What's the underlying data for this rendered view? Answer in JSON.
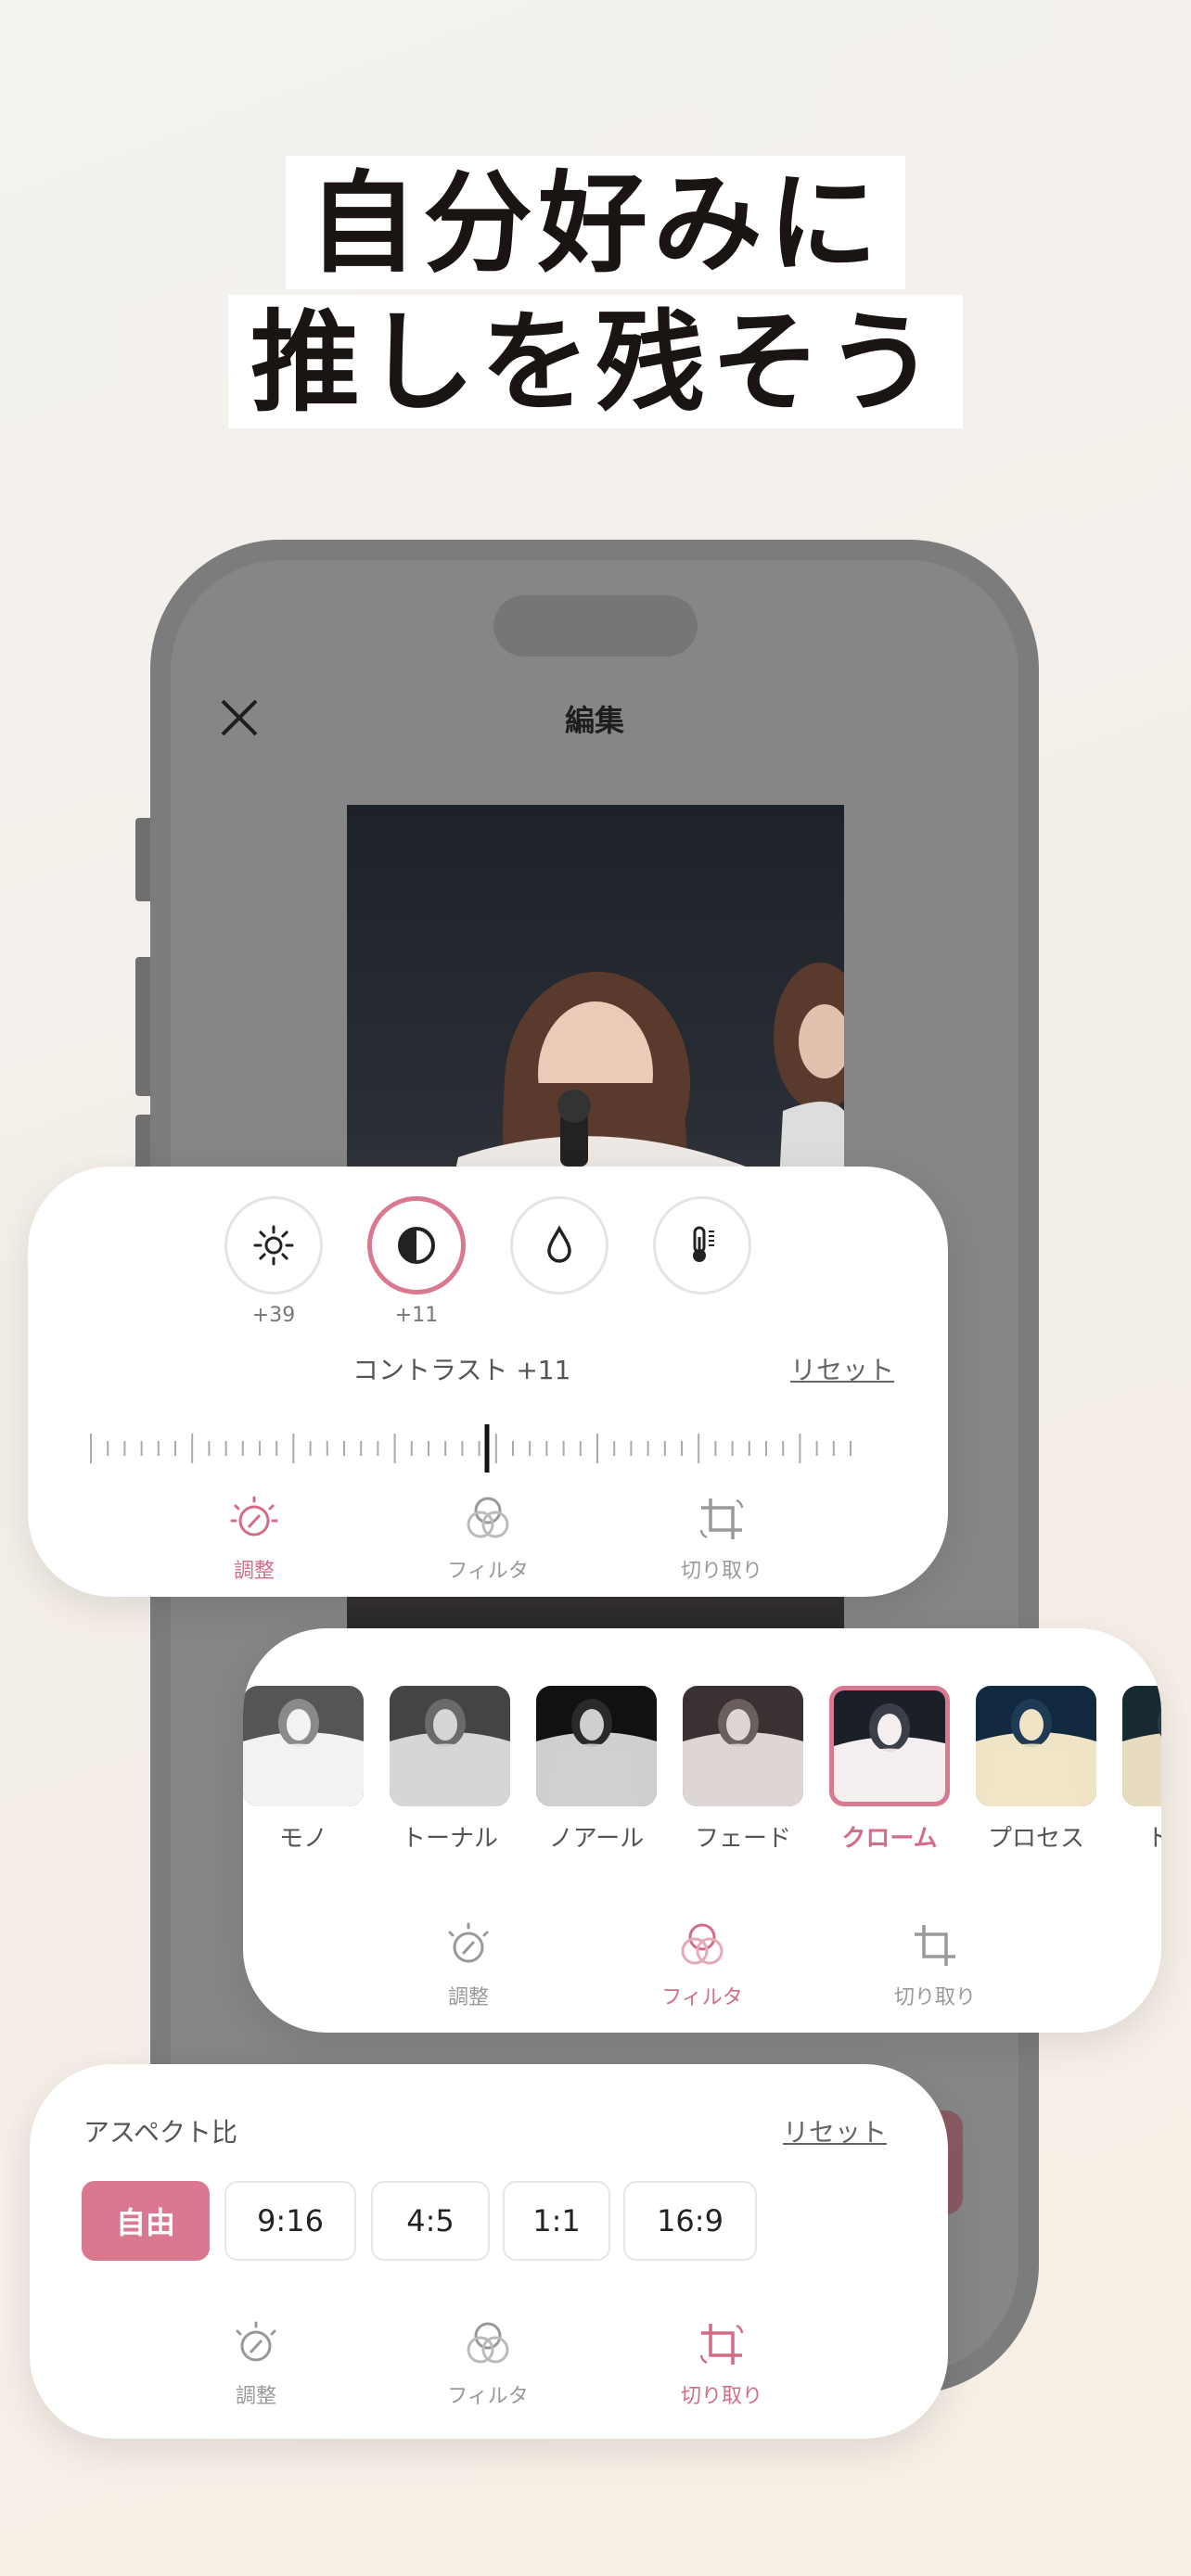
{
  "headline": {
    "line1": "自分好みに",
    "line2": "推しを残そう"
  },
  "editor": {
    "title": "編集"
  },
  "adjust_panel": {
    "tools": [
      {
        "icon": "brightness-icon",
        "value": "+39"
      },
      {
        "icon": "contrast-icon",
        "value": "+11"
      },
      {
        "icon": "saturation-drop-icon",
        "value": ""
      },
      {
        "icon": "temperature-icon",
        "value": ""
      }
    ],
    "slider_label": "コントラスト +11",
    "slider_value": 11,
    "reset": "リセット"
  },
  "tabs": {
    "adjust": "調整",
    "filter": "フィルタ",
    "crop": "切り取り"
  },
  "filters": {
    "items": [
      "モノ",
      "トーナル",
      "ノアール",
      "フェード",
      "クローム",
      "プロセス",
      "トラン"
    ],
    "selected": "クローム"
  },
  "aspect_panel": {
    "label": "アスペクト比",
    "reset": "リセット",
    "options": [
      "自由",
      "9:16",
      "4:5",
      "1:1",
      "16:9"
    ],
    "selected": "自由"
  },
  "colors": {
    "accent": "#d9788f",
    "accent_text": "#d36d86",
    "dim": "#7c7c7c"
  }
}
